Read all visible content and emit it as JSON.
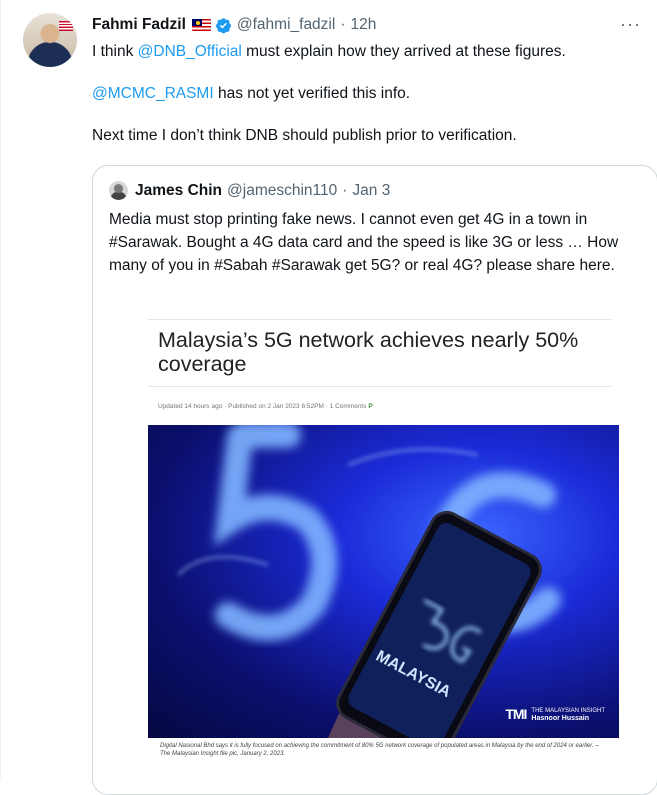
{
  "tweet": {
    "author_name": "Fahmi Fadzil",
    "handle": "@fahmi_fadzil",
    "separator": "·",
    "time": "12h",
    "more": "···",
    "line1_pre": "I think ",
    "line1_mention": "@DNB_Official",
    "line1_post": " must explain how they arrived at these figures.",
    "line2_mention": "@MCMC_RASMI",
    "line2_post": " has not yet verified this info.",
    "line3": "Next time I don’t think DNB should publish prior to verification."
  },
  "quote": {
    "author_name": "James Chin",
    "handle": "@jameschin110",
    "separator": "·",
    "date": "Jan 3",
    "text": "Media must stop printing fake news. I cannot even get 4G in a town in #Sarawak. Bought a 4G data card and the speed is like 3G or less … How many of you in #Sabah #Sarawak get 5G? or real 4G? please share here."
  },
  "article": {
    "title": "Malaysia’s 5G network achieves nearly 50% coverage",
    "meta": "Updated 14 hours ago · Published on 2 Jan 2023 6:52PM · 1 Comments",
    "meta_p": "P",
    "image_badge_top": "5G",
    "image_badge_text": "MALAYSIA",
    "watermark_logo": "TMI",
    "watermark_line1": "THE MALAYSIAN INSIGHT",
    "watermark_line2": "Hasnoor Hussain",
    "caption": "Digital Nasional Bhd says it is fully focused on achieving the commitment of 80% 5G network coverage of populated areas in Malaysia by the end of 2024 or earlier. – The Malaysian Insight file pic, January 2, 2023."
  },
  "colors": {
    "link": "#1d9bf0",
    "verified": "#1d9bf0",
    "secondary": "#536471"
  }
}
